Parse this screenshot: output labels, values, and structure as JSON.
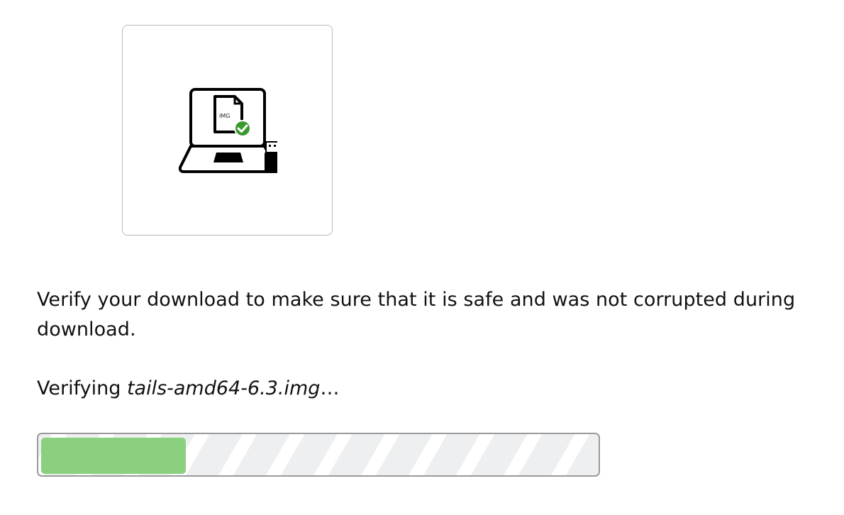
{
  "illustration": {
    "icon": "laptop-verify-usb-icon",
    "file_label": "IMG",
    "check_color": "#3a9a2f"
  },
  "intro": {
    "text": "Verify your download to make sure that it is safe and was not corrupted during download."
  },
  "status": {
    "prefix": "Verifying ",
    "filename": "tails-amd64-6.3.img",
    "suffix": "…"
  },
  "progress": {
    "fraction": 0.26,
    "fill_color": "#8bd07f"
  }
}
